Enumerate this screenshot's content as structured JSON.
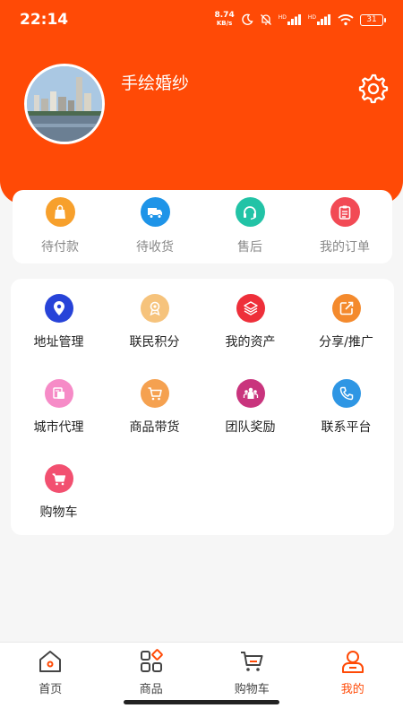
{
  "status_bar": {
    "time": "22:14",
    "net_speed_value": "8.74",
    "net_speed_unit": "KB/s",
    "hd1": "HD",
    "hd2": "HD",
    "battery": "31"
  },
  "profile": {
    "username": "手绘婚纱",
    "avatar_icon": "city-skyline-photo",
    "settings_icon": "gear-icon"
  },
  "orders": [
    {
      "label": "待付款",
      "icon": "shopping-bag-icon",
      "color": "#f7a02c"
    },
    {
      "label": "待收货",
      "icon": "truck-icon",
      "color": "#1e94e8"
    },
    {
      "label": "售后",
      "icon": "headset-icon",
      "color": "#22c3a6"
    },
    {
      "label": "我的订单",
      "icon": "clipboard-icon",
      "color": "#f24a55"
    }
  ],
  "services": [
    {
      "label": "地址管理",
      "icon": "location-pin-icon",
      "color": "#2743d8"
    },
    {
      "label": "联民积分",
      "icon": "badge-icon",
      "color": "#f6c37c"
    },
    {
      "label": "我的资产",
      "icon": "layers-icon",
      "color": "#ee2f3a"
    },
    {
      "label": "分享/推广",
      "icon": "share-icon",
      "color": "#f48a2d"
    },
    {
      "label": "城市代理",
      "icon": "agent-icon",
      "color": "#f68bc7"
    },
    {
      "label": "商品带货",
      "icon": "cart-icon",
      "color": "#f5a150"
    },
    {
      "label": "团队奖励",
      "icon": "team-icon",
      "color": "#c9347d"
    },
    {
      "label": "联系平台",
      "icon": "phone-icon",
      "color": "#2e96e4"
    },
    {
      "label": "购物车",
      "icon": "basket-icon",
      "color": "#f25070"
    }
  ],
  "tabbar": {
    "active_color": "#ff4a06",
    "tabs": [
      {
        "label": "首页",
        "icon": "home-icon"
      },
      {
        "label": "商品",
        "icon": "grid-icon"
      },
      {
        "label": "购物车",
        "icon": "cart-icon"
      },
      {
        "label": "我的",
        "icon": "user-icon",
        "active": true
      }
    ]
  }
}
